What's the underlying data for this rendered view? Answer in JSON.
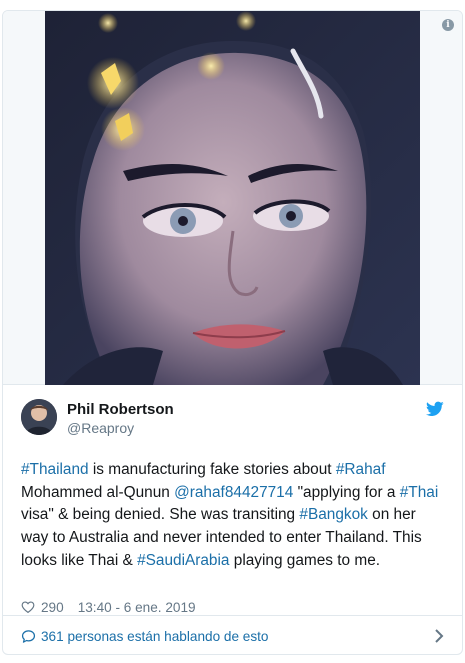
{
  "tweet": {
    "author_name": "Phil Robertson",
    "author_handle": "@Reaproy",
    "text_parts": [
      "#Thailand",
      " is manufacturing fake stories about ",
      "#Rahaf",
      " Mohammed al-Qunun ",
      "@rahaf84427714",
      " \"applying for a ",
      "#Thai",
      " visa\" & being denied. She was transiting ",
      "#Bangkok",
      " on her way to Australia and never intended to enter Thailand. This looks like Thai & ",
      "#SaudiArabia",
      " playing games to me."
    ],
    "likes": "290",
    "timestamp": "13:40 - 6 ene. 2019"
  },
  "footer": {
    "people_talking": "361 personas están hablando de esto"
  },
  "info": {
    "glyph": "i"
  },
  "colors": {
    "link": "#1b6fa8",
    "twitter_blue": "#1da1f2",
    "muted": "#657786",
    "border": "#e1e8ed"
  },
  "icons": [
    "info-icon",
    "twitter-bird-icon",
    "heart-icon",
    "speech-bubble-icon",
    "chevron-right-icon"
  ]
}
